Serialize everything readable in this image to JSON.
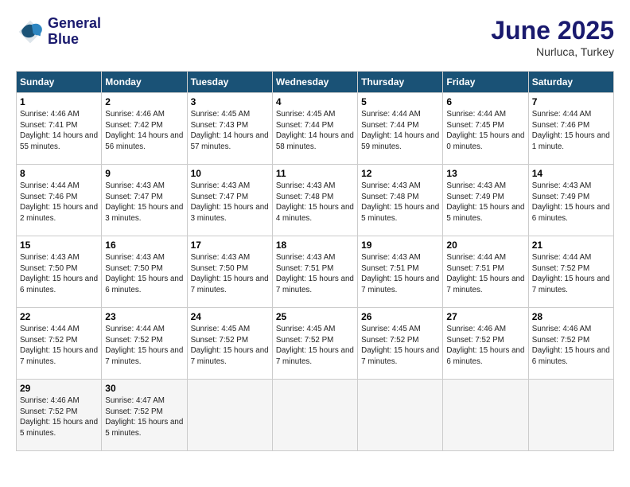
{
  "header": {
    "logo_line1": "General",
    "logo_line2": "Blue",
    "month_year": "June 2025",
    "location": "Nurluca, Turkey"
  },
  "days_of_week": [
    "Sunday",
    "Monday",
    "Tuesday",
    "Wednesday",
    "Thursday",
    "Friday",
    "Saturday"
  ],
  "weeks": [
    [
      {
        "day": 1,
        "sunrise": "4:46 AM",
        "sunset": "7:41 PM",
        "daylight": "14 hours and 55 minutes."
      },
      {
        "day": 2,
        "sunrise": "4:46 AM",
        "sunset": "7:42 PM",
        "daylight": "14 hours and 56 minutes."
      },
      {
        "day": 3,
        "sunrise": "4:45 AM",
        "sunset": "7:43 PM",
        "daylight": "14 hours and 57 minutes."
      },
      {
        "day": 4,
        "sunrise": "4:45 AM",
        "sunset": "7:44 PM",
        "daylight": "14 hours and 58 minutes."
      },
      {
        "day": 5,
        "sunrise": "4:44 AM",
        "sunset": "7:44 PM",
        "daylight": "14 hours and 59 minutes."
      },
      {
        "day": 6,
        "sunrise": "4:44 AM",
        "sunset": "7:45 PM",
        "daylight": "15 hours and 0 minutes."
      },
      {
        "day": 7,
        "sunrise": "4:44 AM",
        "sunset": "7:46 PM",
        "daylight": "15 hours and 1 minute."
      }
    ],
    [
      {
        "day": 8,
        "sunrise": "4:44 AM",
        "sunset": "7:46 PM",
        "daylight": "15 hours and 2 minutes."
      },
      {
        "day": 9,
        "sunrise": "4:43 AM",
        "sunset": "7:47 PM",
        "daylight": "15 hours and 3 minutes."
      },
      {
        "day": 10,
        "sunrise": "4:43 AM",
        "sunset": "7:47 PM",
        "daylight": "15 hours and 3 minutes."
      },
      {
        "day": 11,
        "sunrise": "4:43 AM",
        "sunset": "7:48 PM",
        "daylight": "15 hours and 4 minutes."
      },
      {
        "day": 12,
        "sunrise": "4:43 AM",
        "sunset": "7:48 PM",
        "daylight": "15 hours and 5 minutes."
      },
      {
        "day": 13,
        "sunrise": "4:43 AM",
        "sunset": "7:49 PM",
        "daylight": "15 hours and 5 minutes."
      },
      {
        "day": 14,
        "sunrise": "4:43 AM",
        "sunset": "7:49 PM",
        "daylight": "15 hours and 6 minutes."
      }
    ],
    [
      {
        "day": 15,
        "sunrise": "4:43 AM",
        "sunset": "7:50 PM",
        "daylight": "15 hours and 6 minutes."
      },
      {
        "day": 16,
        "sunrise": "4:43 AM",
        "sunset": "7:50 PM",
        "daylight": "15 hours and 6 minutes."
      },
      {
        "day": 17,
        "sunrise": "4:43 AM",
        "sunset": "7:50 PM",
        "daylight": "15 hours and 7 minutes."
      },
      {
        "day": 18,
        "sunrise": "4:43 AM",
        "sunset": "7:51 PM",
        "daylight": "15 hours and 7 minutes."
      },
      {
        "day": 19,
        "sunrise": "4:43 AM",
        "sunset": "7:51 PM",
        "daylight": "15 hours and 7 minutes."
      },
      {
        "day": 20,
        "sunrise": "4:44 AM",
        "sunset": "7:51 PM",
        "daylight": "15 hours and 7 minutes."
      },
      {
        "day": 21,
        "sunrise": "4:44 AM",
        "sunset": "7:52 PM",
        "daylight": "15 hours and 7 minutes."
      }
    ],
    [
      {
        "day": 22,
        "sunrise": "4:44 AM",
        "sunset": "7:52 PM",
        "daylight": "15 hours and 7 minutes."
      },
      {
        "day": 23,
        "sunrise": "4:44 AM",
        "sunset": "7:52 PM",
        "daylight": "15 hours and 7 minutes."
      },
      {
        "day": 24,
        "sunrise": "4:45 AM",
        "sunset": "7:52 PM",
        "daylight": "15 hours and 7 minutes."
      },
      {
        "day": 25,
        "sunrise": "4:45 AM",
        "sunset": "7:52 PM",
        "daylight": "15 hours and 7 minutes."
      },
      {
        "day": 26,
        "sunrise": "4:45 AM",
        "sunset": "7:52 PM",
        "daylight": "15 hours and 7 minutes."
      },
      {
        "day": 27,
        "sunrise": "4:46 AM",
        "sunset": "7:52 PM",
        "daylight": "15 hours and 6 minutes."
      },
      {
        "day": 28,
        "sunrise": "4:46 AM",
        "sunset": "7:52 PM",
        "daylight": "15 hours and 6 minutes."
      }
    ],
    [
      {
        "day": 29,
        "sunrise": "4:46 AM",
        "sunset": "7:52 PM",
        "daylight": "15 hours and 5 minutes."
      },
      {
        "day": 30,
        "sunrise": "4:47 AM",
        "sunset": "7:52 PM",
        "daylight": "15 hours and 5 minutes."
      },
      null,
      null,
      null,
      null,
      null
    ]
  ]
}
